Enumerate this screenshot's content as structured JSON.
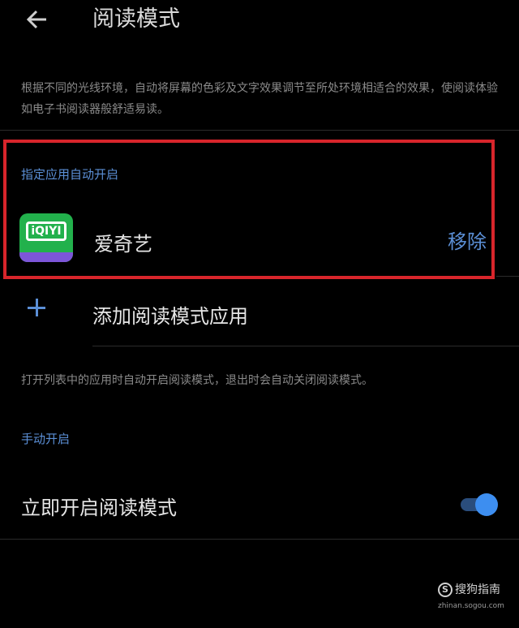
{
  "header": {
    "back_icon": "arrow-left-icon",
    "title": "阅读模式"
  },
  "description": "根据不同的光线环境，自动将屏幕的色彩及文字效果调节至所处环境相适合的效果，使阅读体验如电子书阅读器般舒适易读。",
  "auto_section": {
    "label": "指定应用自动开启",
    "apps": [
      {
        "name": "爱奇艺",
        "icon": "iqiyi-app-icon",
        "icon_text": "iQIYI",
        "action_label": "移除"
      }
    ],
    "add_label": "添加阅读模式应用",
    "add_icon": "plus-icon",
    "note": "打开列表中的应用时自动开启阅读模式，退出时会自动关闭阅读模式。"
  },
  "manual_section": {
    "label": "手动开启",
    "toggle_label": "立即开启阅读模式",
    "toggle_on": true
  },
  "watermark": {
    "text": "搜狗指南",
    "url": "zhinan.sogou.com"
  },
  "colors": {
    "background": "#000000",
    "accent": "#5b8fd6",
    "highlight_border": "#d8252b",
    "toggle": "#3d8ef0"
  }
}
